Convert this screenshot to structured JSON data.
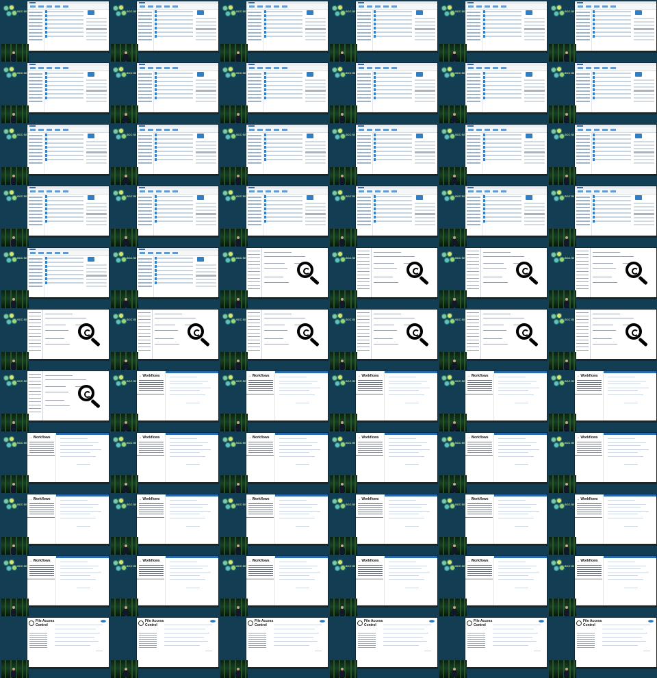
{
  "sheet": {
    "background": "#123d52",
    "columns": 6,
    "rows": 11,
    "logo_text": "SCC SECURE",
    "slide_sequence": [
      "explorer",
      "explorer",
      "explorer",
      "explorer",
      "explorer",
      "explorer",
      "explorer",
      "explorer",
      "explorer",
      "explorer",
      "explorer",
      "explorer",
      "explorer",
      "explorer",
      "explorer",
      "explorer",
      "explorer",
      "explorer",
      "explorer",
      "explorer",
      "explorer",
      "explorer",
      "explorer",
      "explorer",
      "explorer",
      "explorer",
      "magnifier",
      "magnifier",
      "magnifier",
      "magnifier",
      "magnifier",
      "magnifier",
      "magnifier",
      "magnifier",
      "magnifier",
      "magnifier",
      "magnifier",
      "workflows",
      "workflows",
      "workflows",
      "workflows",
      "workflows",
      "workflows",
      "workflows",
      "workflows",
      "workflows",
      "workflows",
      "workflows",
      "workflows",
      "workflows",
      "workflows",
      "workflows",
      "workflows",
      "workflows",
      "workflows",
      "workflows",
      "workflows",
      "workflows",
      "workflows",
      "workflows",
      "fileaccess",
      "fileaccess",
      "fileaccess",
      "fileaccess",
      "fileaccess",
      "fileaccess"
    ]
  },
  "slides": {
    "workflows": {
      "title": "Workflows"
    },
    "fileaccess": {
      "title": "File Access Control"
    }
  }
}
